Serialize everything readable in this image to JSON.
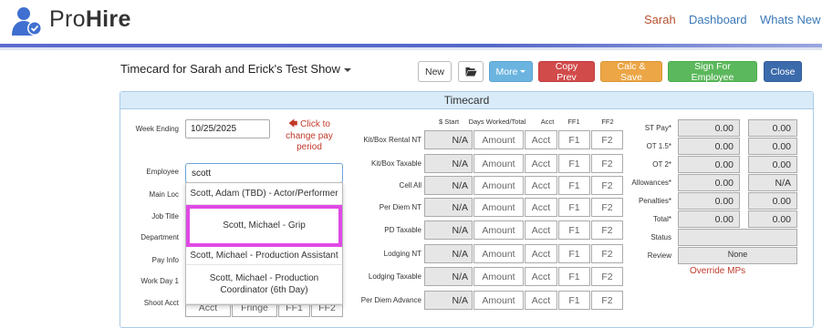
{
  "header": {
    "brand_light": "Pro",
    "brand_bold": "Hire",
    "nav": {
      "user": "Sarah",
      "dashboard": "Dashboard",
      "whats_new": "Whats New"
    }
  },
  "toolbar": {
    "title": "Timecard for Sarah and Erick's Test Show",
    "new": "New",
    "more": "More",
    "copy_prev": "Copy Prev",
    "calc_save": "Calc & Save",
    "sign": "Sign For Employee",
    "close": "Close"
  },
  "panel": {
    "title": "Timecard",
    "week_ending_label": "Week Ending",
    "week_ending_value": "10/25/2025",
    "hint": "Click to change pay period",
    "employee_label": "Employee",
    "employee_value": "scott",
    "left_labels": [
      "Main Loc",
      "Job Title",
      "Department",
      "Pay Info",
      "Work Day 1",
      "Shoot Acct"
    ],
    "col_heads": {
      "start": "$ Start",
      "days": "Days Worked/Total",
      "acct": "Acct",
      "ff1": "FF1",
      "ff2": "FF2"
    },
    "cell_text": {
      "na": "N/A",
      "amount": "Amount",
      "acct": "Acct",
      "ff1": "F1",
      "ff2": "F2"
    },
    "row_labels": [
      "Kit/Box Rental NT",
      "Kit/Box Taxable",
      "Cell All",
      "Per Diem NT",
      "PD Taxable",
      "Lodging NT",
      "Lodging Taxable",
      "Per Diem Advance"
    ],
    "summary": [
      {
        "label": "ST Pay*",
        "a": "0.00",
        "b": "0.00"
      },
      {
        "label": "OT 1.5*",
        "a": "0.00",
        "b": "0.00"
      },
      {
        "label": "OT 2*",
        "a": "0.00",
        "b": "0.00"
      },
      {
        "label": "Allowances*",
        "a": "0.00",
        "b": "N/A"
      },
      {
        "label": "Penalties*",
        "a": "0.00",
        "b": "0.00"
      },
      {
        "label": "Total*",
        "a": "0.00",
        "b": "0.00"
      }
    ],
    "status_label": "Status",
    "review_label": "Review",
    "review_value": "None",
    "override": "Override MPs",
    "shoot_acct_cells": [
      "Acct",
      "Fringe",
      "FF1",
      "FF2"
    ]
  },
  "dropdown": {
    "options": [
      "Scott, Adam (TBD) - Actor/Performer",
      "Scott, Michael - Grip",
      "Scott, Michael - Production Assistant",
      "Scott, Michael - Production Coordinator (6th Day)"
    ],
    "highlighted_index": 1,
    "highlight_color": "#e04ae6"
  },
  "colors": {
    "brand_blue": "#3a78b8",
    "user_link": "#b5502e",
    "more": "#6cb4e0",
    "copy_prev": "#d24b4b",
    "calc_save": "#eca646",
    "sign": "#5cb85c",
    "close": "#3c6bab",
    "hint_red": "#c03a2b"
  },
  "icons": {
    "logo": "user-check-icon",
    "open": "folder-open-icon"
  }
}
